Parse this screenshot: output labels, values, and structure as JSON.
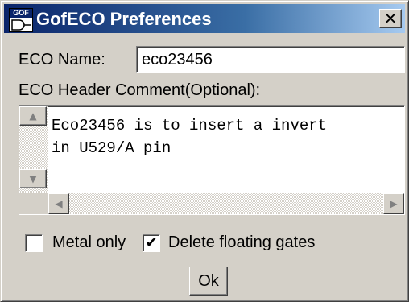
{
  "window": {
    "title": "GofECO Preferences",
    "icon_text": "GOF",
    "close_symbol": "✕"
  },
  "form": {
    "eco_name_label": "ECO Name:",
    "eco_name_value": "eco23456",
    "header_comment_label": "ECO Header Comment(Optional):",
    "header_comment_value": "Eco23456 is to insert a invert\nin U529/A pin"
  },
  "options": {
    "metal_only": {
      "label": "Metal only",
      "checked": false
    },
    "delete_floating_gates": {
      "label": "Delete floating gates",
      "checked": true
    }
  },
  "buttons": {
    "ok_label": "Ok"
  },
  "icons": {
    "up_arrow": "▲",
    "down_arrow": "▼",
    "left_arrow": "◀",
    "right_arrow": "▶",
    "check_mark": "✔"
  },
  "colors": {
    "title_bar_start": "#0a246a",
    "title_bar_end": "#a6caf0",
    "dialog_face": "#d4d0c8"
  }
}
